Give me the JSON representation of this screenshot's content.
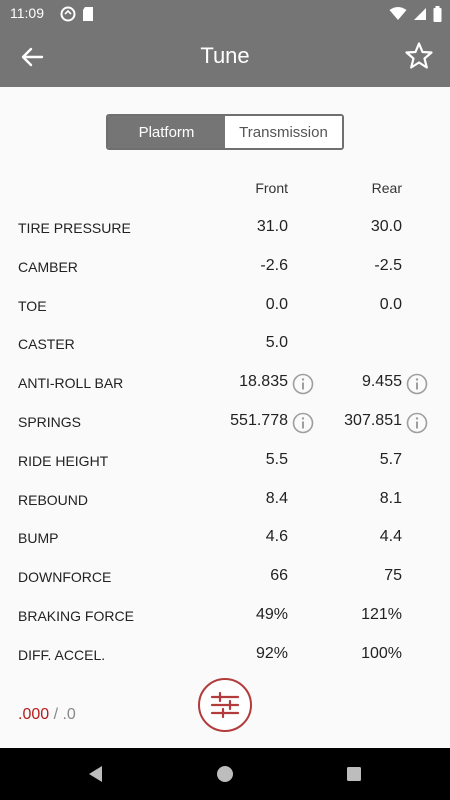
{
  "status": {
    "time": "11:09",
    "icons": [
      "sync-icon",
      "sd-card-icon",
      "wifi-icon",
      "signal-icon",
      "battery-icon"
    ]
  },
  "app_bar": {
    "title": "Tune",
    "back_icon": "arrow-back-icon",
    "fav_icon": "star-outline-icon"
  },
  "tabs": [
    {
      "label": "Platform",
      "active": true
    },
    {
      "label": "Transmission",
      "active": false
    }
  ],
  "columns": {
    "front": "Front",
    "rear": "Rear"
  },
  "rows": [
    {
      "label": "TIRE PRESSURE",
      "front": "31.0",
      "rear": "30.0"
    },
    {
      "label": "CAMBER",
      "front": "-2.6",
      "rear": "-2.5"
    },
    {
      "label": "TOE",
      "front": "0.0",
      "rear": "0.0"
    },
    {
      "label": "CASTER",
      "front": "5.0",
      "rear": ""
    },
    {
      "label": "ANTI-ROLL BAR",
      "front": "18.835",
      "rear": "9.455"
    },
    {
      "label": "SPRINGS",
      "front": "551.778",
      "rear": "307.851"
    },
    {
      "label": "RIDE HEIGHT",
      "front": "5.5",
      "rear": "5.7"
    },
    {
      "label": "REBOUND",
      "front": "8.4",
      "rear": "8.1"
    },
    {
      "label": "BUMP",
      "front": "4.6",
      "rear": "4.4"
    },
    {
      "label": "DOWNFORCE",
      "front": "66",
      "rear": "75"
    },
    {
      "label": "BRAKING FORCE",
      "front": "49%",
      "rear": "121%"
    },
    {
      "label": "DIFF. ACCEL.",
      "front": "92%",
      "rear": "100%"
    }
  ],
  "footer": {
    "score_main": ".000",
    "score_sep": " / ",
    "score_sub": ".0",
    "fab_icon": "sliders-icon"
  },
  "colors": {
    "appbar": "#757575",
    "accent": "#b23b3b",
    "score": "#b71c1c"
  }
}
